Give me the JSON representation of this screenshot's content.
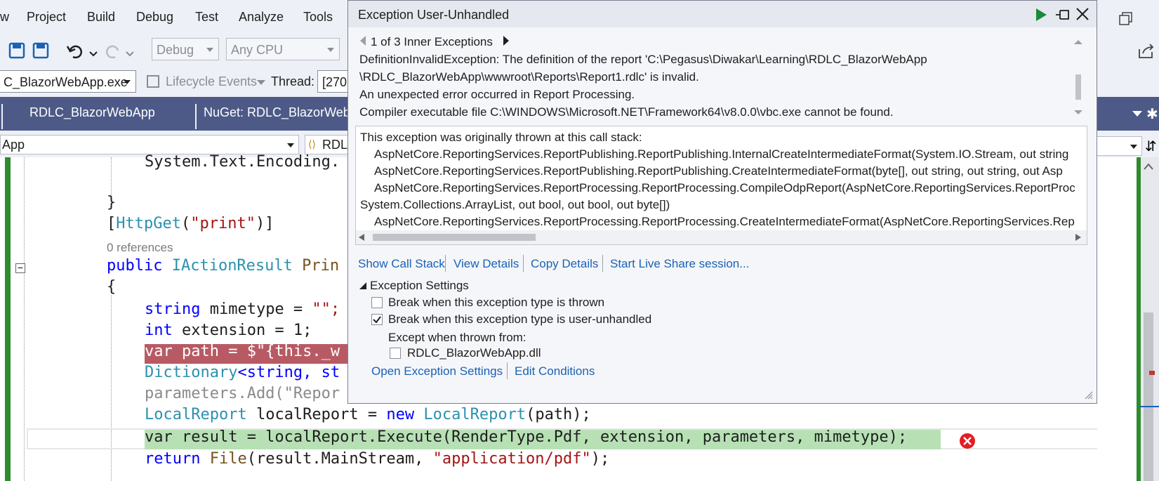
{
  "menu": [
    "w",
    "Project",
    "Build",
    "Debug",
    "Test",
    "Analyze",
    "Tools"
  ],
  "toolbar": {
    "config": "Debug",
    "platform": "Any CPU"
  },
  "toolbar2": {
    "process": "C_BlazorWebApp.exe",
    "lifecycle": "Lifecycle Events",
    "thread_label": "Thread:",
    "thread_value": "[270"
  },
  "tabs": [
    "RDLC_BlazorWebApp",
    "NuGet: RDLC_BlazorWebAp"
  ],
  "nav": {
    "left": "App",
    "right": "RDLC"
  },
  "code": {
    "l1": "System.Text.Encoding.",
    "l2": "}",
    "l3a": "[",
    "l3b": "HttpGet",
    "l3c": "(",
    "l3d": "\"print\"",
    "l3e": ")]",
    "refs": "0 references",
    "l5a": "public ",
    "l5b": "IActionResult ",
    "l5c": "Prin",
    "l6": "{",
    "l7a": "string ",
    "l7b": "mimetype = ",
    "l7c": "\"\";",
    "l8a": "int ",
    "l8b": "extension = 1;",
    "l9": "var path = $\"{this._w",
    "l10a": "Dictionary",
    "l10b": "<string, st",
    "l11": "parameters.Add(\"Repor",
    "l12a": "LocalReport ",
    "l12b": "localReport = ",
    "l12c": "new ",
    "l12d": "LocalReport",
    "l12e": "(path);",
    "l13": "var result = localReport.Execute(RenderType.Pdf, extension, parameters, mimetype);",
    "l14a": "return ",
    "l14b": "File",
    "l14c": "(result.MainStream, ",
    "l14d": "\"application/pdf\"",
    "l14e": ");"
  },
  "dialog": {
    "title": "Exception User-Unhandled",
    "inner": "1 of 3 Inner Exceptions",
    "msg1": "DefinitionInvalidException: The definition of the report 'C:\\Pegasus\\Diwakar\\Learning\\RDLC_BlazorWebApp",
    "msg2": "\\RDLC_BlazorWebApp\\wwwroot\\Reports\\Report1.rdlc' is invalid.",
    "msg3": "An unexpected error occurred in Report Processing.",
    "msg4": "Compiler executable file C:\\WINDOWS\\Microsoft.NET\\Framework64\\v8.0.0\\vbc.exe cannot be found.",
    "stack": [
      "This exception was originally thrown at this call stack:",
      "AspNetCore.ReportingServices.ReportPublishing.ReportPublishing.InternalCreateIntermediateFormat(System.IO.Stream, out string",
      "AspNetCore.ReportingServices.ReportPublishing.ReportPublishing.CreateIntermediateFormat(byte[], out string, out string, out Asp",
      "AspNetCore.ReportingServices.ReportProcessing.ReportProcessing.CompileOdpReport(AspNetCore.ReportingServices.ReportProc",
      "System.Collections.ArrayList, out bool, out bool, out byte[])",
      "AspNetCore.ReportingServices.ReportProcessing.ReportProcessing.CreateIntermediateFormat(AspNetCore.ReportingServices.Rep"
    ],
    "links": [
      "Show Call Stack",
      "View Details",
      "Copy Details",
      "Start Live Share session..."
    ],
    "settings_title": "Exception Settings",
    "cb1": "Break when this exception type is thrown",
    "cb2": "Break when this exception type is user-unhandled",
    "except": "Except when thrown from:",
    "cb3": "RDLC_BlazorWebApp.dll",
    "open": "Open Exception Settings",
    "edit": "Edit Conditions"
  }
}
